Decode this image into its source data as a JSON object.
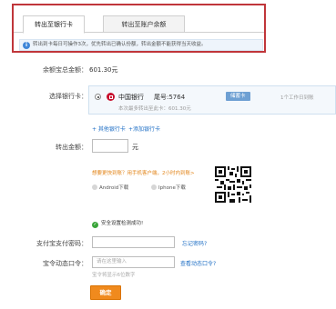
{
  "tabs": [
    {
      "label": "转出至银行卡",
      "active": true
    },
    {
      "label": "转出至账户余额",
      "active": false
    }
  ],
  "notice": "转出到卡每日可操作3次，优先转出已确认份额，转出金额不能获得当天收益。",
  "balance": {
    "label": "余额宝总金额：",
    "value": "601.30元"
  },
  "bank_section": {
    "label": "选择银行卡：",
    "bank_name": "中国银行",
    "card_tail": "尾号:5764",
    "card_type": "储蓄卡",
    "arrival": "1个工作日到账",
    "note": "本次最多转出至此卡：601.30元"
  },
  "links": {
    "other_cards": "+ 其他银行卡",
    "add_card": "+添加银行卡"
  },
  "amount": {
    "label": "转出金额：",
    "unit": "元"
  },
  "app_promo": "想要更快到账？用手机客户端，2小时内到账>",
  "downloads": {
    "android": "Android下载",
    "iphone": "Iphone下载"
  },
  "security_check": "安全设置检测成功!",
  "password": {
    "label": "支付宝支付密码：",
    "forgot": "忘记密码?"
  },
  "token": {
    "label": "宝令动态口令：",
    "placeholder": "请在这里输入",
    "view": "查看动态口令?",
    "tip": "宝令将显示6位数字"
  },
  "confirm_label": "确定",
  "colors": {
    "accent": "#f08a1d",
    "highlight": "#c0363a",
    "link": "#1f6fc5"
  }
}
